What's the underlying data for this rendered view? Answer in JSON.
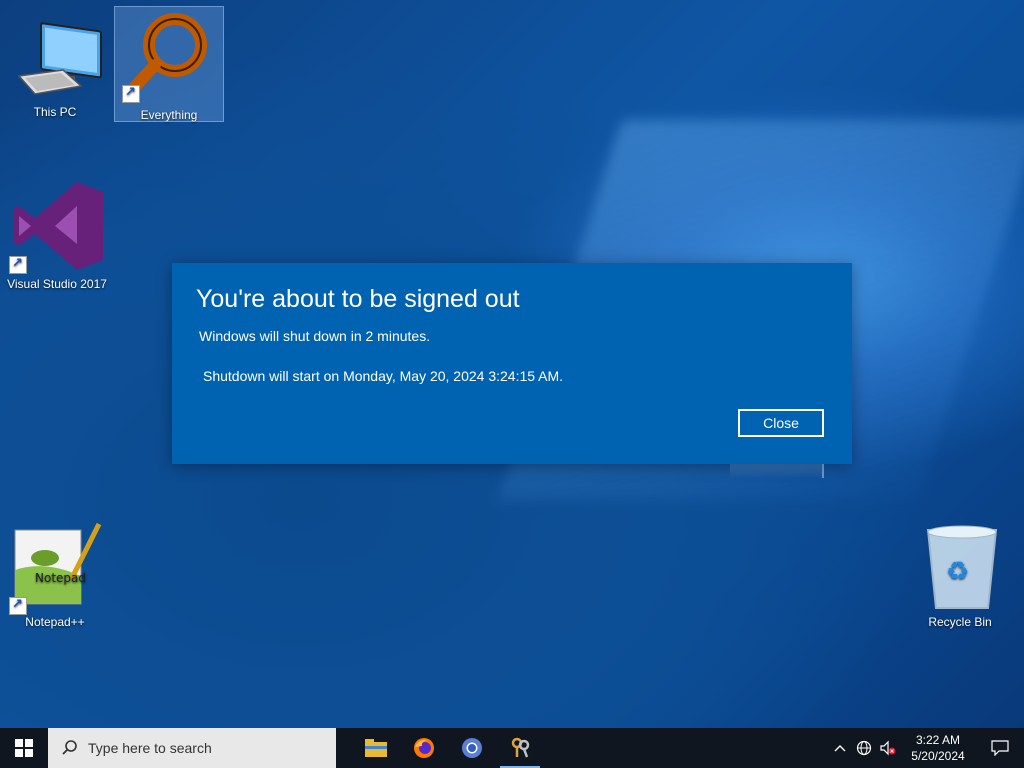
{
  "desktop": {
    "icons": [
      {
        "label": "This PC"
      },
      {
        "label": "Everything"
      },
      {
        "label": "Visual Studio 2017"
      },
      {
        "label": "Notepad++"
      },
      {
        "label": "Recycle Bin"
      }
    ]
  },
  "dialog": {
    "title": "You're about to be signed out",
    "message": "Windows will shut down in 2 minutes.",
    "detail": "Shutdown will start on Monday, May 20, 2024 3:24:15 AM.",
    "close_label": "Close"
  },
  "taskbar": {
    "search_placeholder": "Type here to search",
    "apps": [
      {
        "name": "file-explorer-icon"
      },
      {
        "name": "firefox-icon"
      },
      {
        "name": "chrome-icon"
      },
      {
        "name": "keys-app-icon"
      }
    ],
    "clock": {
      "time": "3:22 AM",
      "date": "5/20/2024"
    }
  },
  "colors": {
    "dialog_bg": "#0063b1",
    "taskbar_bg": "#0f1620",
    "accent": "#0078d7"
  }
}
